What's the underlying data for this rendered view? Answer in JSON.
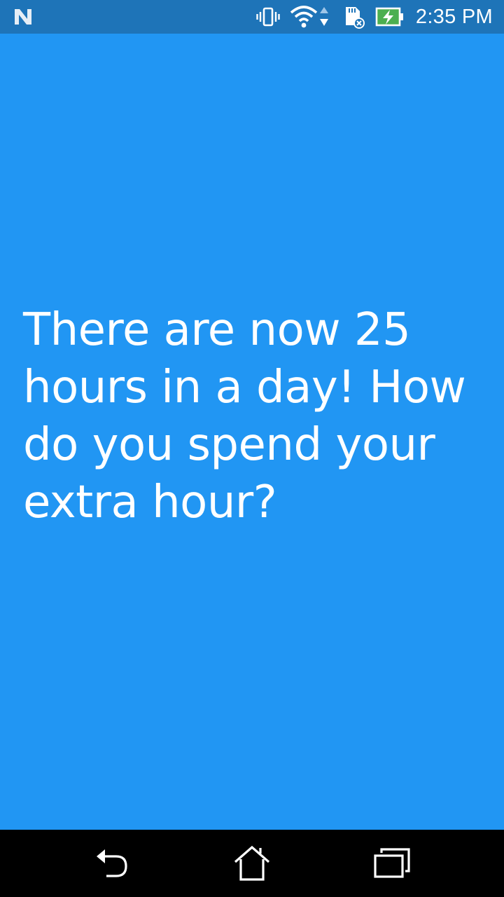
{
  "status_bar": {
    "time": "2:35 PM",
    "icons": [
      "n-notification-icon",
      "vibrate-icon",
      "wifi-icon",
      "sd-card-icon",
      "battery-charging-icon"
    ],
    "background_color": "#1E74B8",
    "battery_color": "#4CAF50"
  },
  "main": {
    "question": "There are now 25 hours in a day! How do you spend your extra hour?",
    "background_color": "#2196F3",
    "text_color": "#FFFFFF"
  },
  "nav_bar": {
    "buttons": [
      "back-icon",
      "home-icon",
      "recents-icon"
    ],
    "background_color": "#000000"
  }
}
